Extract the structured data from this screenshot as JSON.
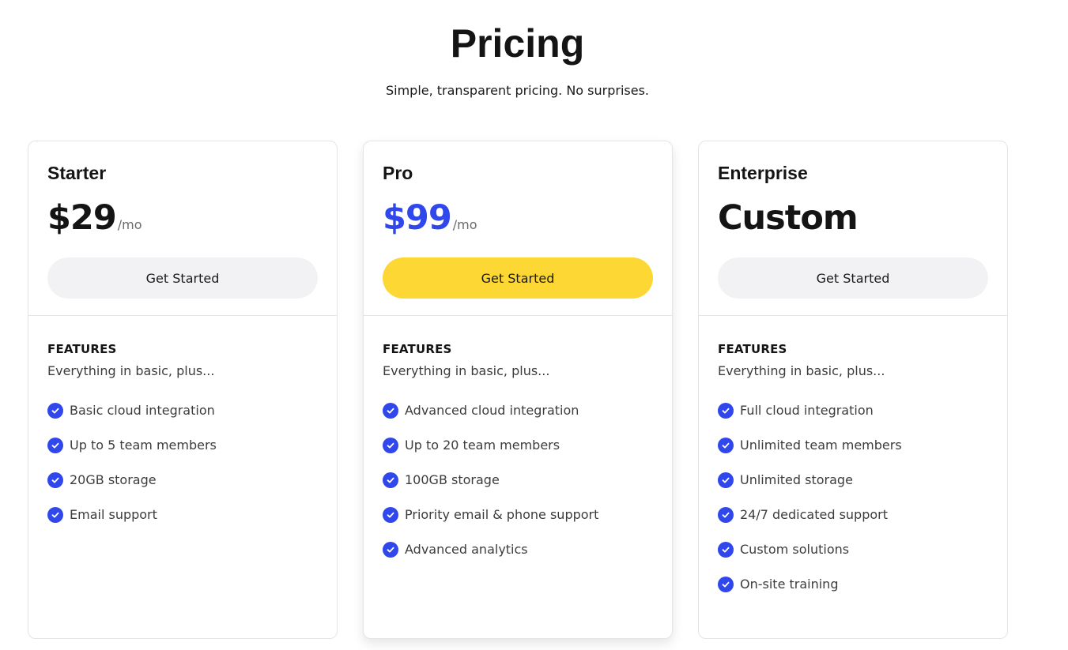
{
  "header": {
    "title": "Pricing",
    "subtitle": "Simple, transparent pricing. No surprises."
  },
  "colors": {
    "accent_blue": "#3047ec",
    "highlight_yellow": "#fdd835",
    "button_gray": "#f2f2f4",
    "border": "#e4e4e7"
  },
  "plans": [
    {
      "name": "Starter",
      "price": "$29",
      "period": "/mo",
      "cta_label": "Get Started",
      "features_heading": "FEATURES",
      "features_subheading": "Everything in basic, plus...",
      "check_icon": "check-circle-icon",
      "features": [
        "Basic cloud integration",
        "Up to 5 team members",
        "20GB storage",
        "Email support"
      ]
    },
    {
      "name": "Pro",
      "price": "$99",
      "period": "/mo",
      "cta_label": "Get Started",
      "features_heading": "FEATURES",
      "features_subheading": "Everything in basic, plus...",
      "check_icon": "check-circle-icon",
      "features": [
        "Advanced cloud integration",
        "Up to 20 team members",
        "100GB storage",
        "Priority email & phone support",
        "Advanced analytics"
      ]
    },
    {
      "name": "Enterprise",
      "price": "Custom",
      "period": "",
      "cta_label": "Get Started",
      "features_heading": "FEATURES",
      "features_subheading": "Everything in basic, plus...",
      "check_icon": "check-circle-icon",
      "features": [
        "Full cloud integration",
        "Unlimited team members",
        "Unlimited storage",
        "24/7 dedicated support",
        "Custom solutions",
        "On-site training"
      ]
    }
  ]
}
